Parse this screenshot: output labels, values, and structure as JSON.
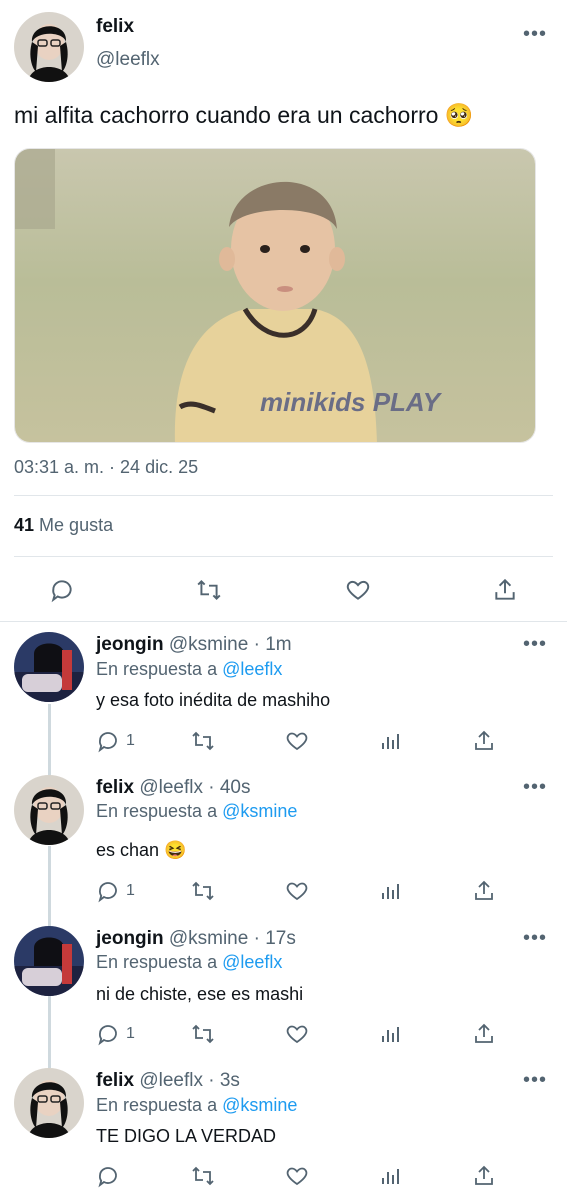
{
  "main_tweet": {
    "name": "felix",
    "handle": "@leeflx",
    "text": "mi alfita cachorro cuando era un cachorro",
    "emoji": "🥺",
    "photo_caption": "minikids PLAY",
    "timestamp": "03:31 a. m. · 24 dic. 25",
    "likes_count": "41",
    "likes_label": "Me gusta"
  },
  "replies": [
    {
      "name": "jeongin",
      "handle": "@ksmine",
      "time": "· 1m",
      "reply_prefix": "En respuesta a",
      "reply_to": "@leeflx",
      "text": "y esa foto inédita de mashiho",
      "emoji": "",
      "reply_count": "1"
    },
    {
      "name": "felix",
      "handle": "@leeflx",
      "time": "· 40s",
      "reply_prefix": "En respuesta a",
      "reply_to": "@ksmine",
      "text": "es chan",
      "emoji": "😆",
      "reply_count": "1"
    },
    {
      "name": "jeongin",
      "handle": "@ksmine",
      "time": "· 17s",
      "reply_prefix": "En respuesta a",
      "reply_to": "@leeflx",
      "text": "ni de chiste, ese es mashi",
      "emoji": "",
      "reply_count": "1"
    },
    {
      "name": "felix",
      "handle": "@leeflx",
      "time": "· 3s",
      "reply_prefix": "En respuesta a",
      "reply_to": "@ksmine",
      "text": "TE DIGO LA VERDAD",
      "emoji": "",
      "reply_count": ""
    }
  ]
}
